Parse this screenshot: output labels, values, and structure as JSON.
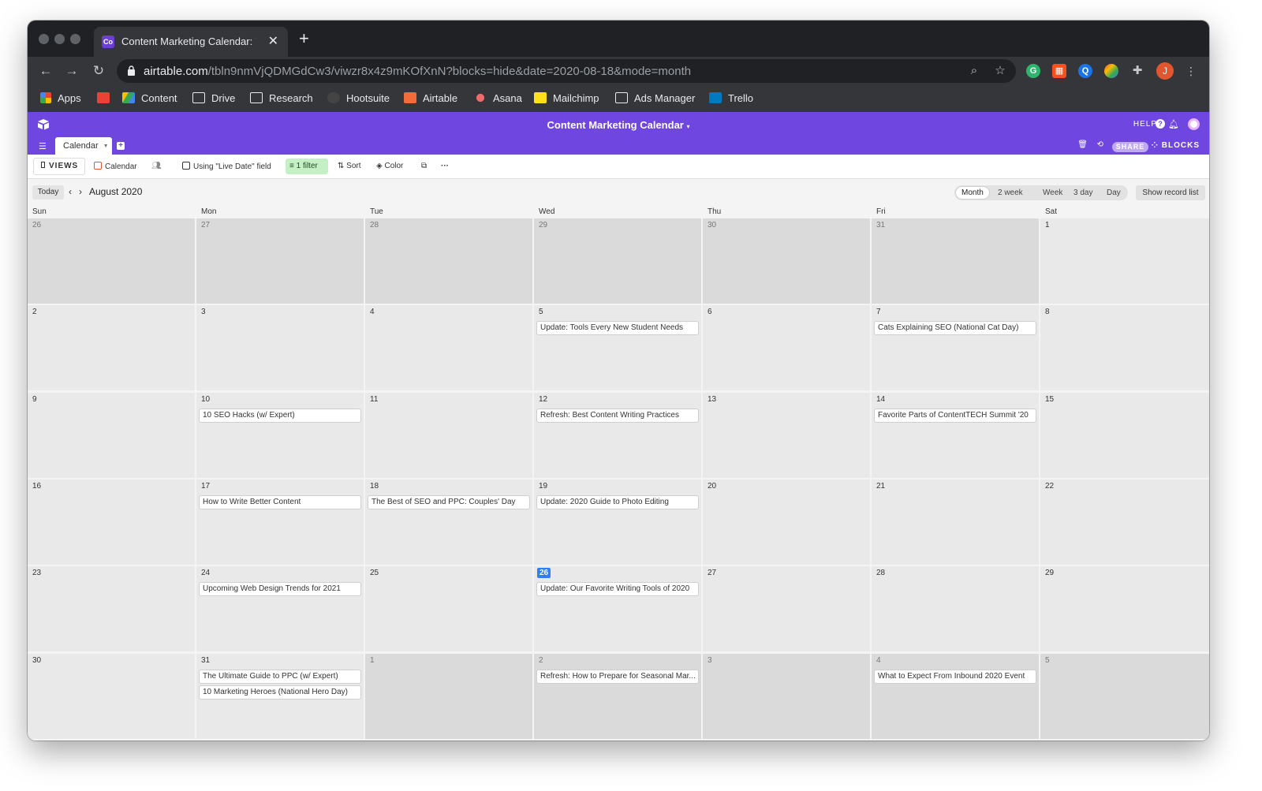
{
  "browser": {
    "tab_title": "Content Marketing Calendar: T",
    "tab_favicon": "Co",
    "new_tab": "+",
    "url_host": "airtable.com",
    "url_path": "/tbln9nmVjQDMGdCw3/viwzr8x4z9mKOfXnN?blocks=hide&date=2020-08-18&mode=month",
    "profile_initial": "J",
    "bookmarks": [
      {
        "label": "Apps",
        "icon": "apps-grid-icon",
        "color": "#ea4335"
      },
      {
        "label": "",
        "icon": "gmail-icon",
        "color": "#ea4335"
      },
      {
        "label": "Content",
        "icon": "google-drive-icon",
        "color": "#34a853"
      },
      {
        "label": "Drive",
        "icon": "folder-icon",
        "color": "#e8eaed"
      },
      {
        "label": "Research",
        "icon": "folder-icon",
        "color": "#e8eaed"
      },
      {
        "label": "Hootsuite",
        "icon": "hootsuite-icon",
        "color": "#e8eaed"
      },
      {
        "label": "Airtable",
        "icon": "airtable-icon",
        "color": "#f26b3a"
      },
      {
        "label": "Asana",
        "icon": "asana-icon",
        "color": "#f06a6a"
      },
      {
        "label": "Mailchimp",
        "icon": "mailchimp-icon",
        "color": "#ffe01b"
      },
      {
        "label": "Ads Manager",
        "icon": "ads-manager-icon",
        "color": "#e8eaed"
      },
      {
        "label": "Trello",
        "icon": "trello-icon",
        "color": "#0079bf"
      }
    ]
  },
  "app": {
    "base_name": "Content Marketing Calendar",
    "help": "HELP",
    "help_icon": "?",
    "table_tab": "Calendar",
    "share": "SHARE",
    "blocks": "BLOCKS",
    "brand_color": "#6f46e0"
  },
  "viewbar": {
    "views": "VIEWS",
    "view_name": "Calendar",
    "date_field": "Using \"Live Date\" field",
    "filter": "1 filter",
    "sort": "Sort",
    "color": "Color",
    "more": "···"
  },
  "calendar": {
    "today": "Today",
    "month_title": "August 2020",
    "modes": [
      "Month",
      "2 week",
      "Week",
      "3 day",
      "Day"
    ],
    "active_mode": "Month",
    "show_record_list": "Show record list",
    "weekdays": [
      "Sun",
      "Mon",
      "Tue",
      "Wed",
      "Thu",
      "Fri",
      "Sat"
    ],
    "today_date": "26",
    "weeks": [
      [
        {
          "d": "26",
          "other": true
        },
        {
          "d": "27",
          "other": true
        },
        {
          "d": "28",
          "other": true
        },
        {
          "d": "29",
          "other": true
        },
        {
          "d": "30",
          "other": true
        },
        {
          "d": "31",
          "other": true
        },
        {
          "d": "1"
        }
      ],
      [
        {
          "d": "2"
        },
        {
          "d": "3"
        },
        {
          "d": "4"
        },
        {
          "d": "5",
          "events": [
            "Update: Tools Every New Student Needs"
          ]
        },
        {
          "d": "6"
        },
        {
          "d": "7",
          "events": [
            "Cats Explaining SEO (National Cat Day)"
          ]
        },
        {
          "d": "8"
        }
      ],
      [
        {
          "d": "9"
        },
        {
          "d": "10",
          "events": [
            "10 SEO Hacks (w/ Expert)"
          ]
        },
        {
          "d": "11"
        },
        {
          "d": "12",
          "events": [
            "Refresh: Best Content Writing Practices"
          ]
        },
        {
          "d": "13"
        },
        {
          "d": "14",
          "events": [
            "Favorite Parts of ContentTECH Summit '20"
          ]
        },
        {
          "d": "15"
        }
      ],
      [
        {
          "d": "16"
        },
        {
          "d": "17",
          "events": [
            "How to Write Better Content"
          ]
        },
        {
          "d": "18",
          "events": [
            "The Best of SEO and PPC: Couples' Day"
          ]
        },
        {
          "d": "19",
          "events": [
            "Update: 2020 Guide to Photo Editing"
          ]
        },
        {
          "d": "20"
        },
        {
          "d": "21"
        },
        {
          "d": "22"
        }
      ],
      [
        {
          "d": "23"
        },
        {
          "d": "24",
          "events": [
            "Upcoming Web Design Trends for 2021"
          ]
        },
        {
          "d": "25"
        },
        {
          "d": "26",
          "today": true,
          "events": [
            "Update: Our Favorite Writing Tools of 2020"
          ]
        },
        {
          "d": "27"
        },
        {
          "d": "28"
        },
        {
          "d": "29"
        }
      ],
      [
        {
          "d": "30"
        },
        {
          "d": "31",
          "events": [
            "The Ultimate Guide to PPC (w/ Expert)",
            "10 Marketing Heroes (National Hero Day)"
          ]
        },
        {
          "d": "1",
          "other": true
        },
        {
          "d": "2",
          "other": true,
          "events": [
            "Refresh: How to Prepare for Seasonal Mar..."
          ]
        },
        {
          "d": "3",
          "other": true
        },
        {
          "d": "4",
          "other": true,
          "events": [
            "What to Expect From Inbound 2020 Event"
          ]
        },
        {
          "d": "5",
          "other": true
        }
      ]
    ]
  }
}
